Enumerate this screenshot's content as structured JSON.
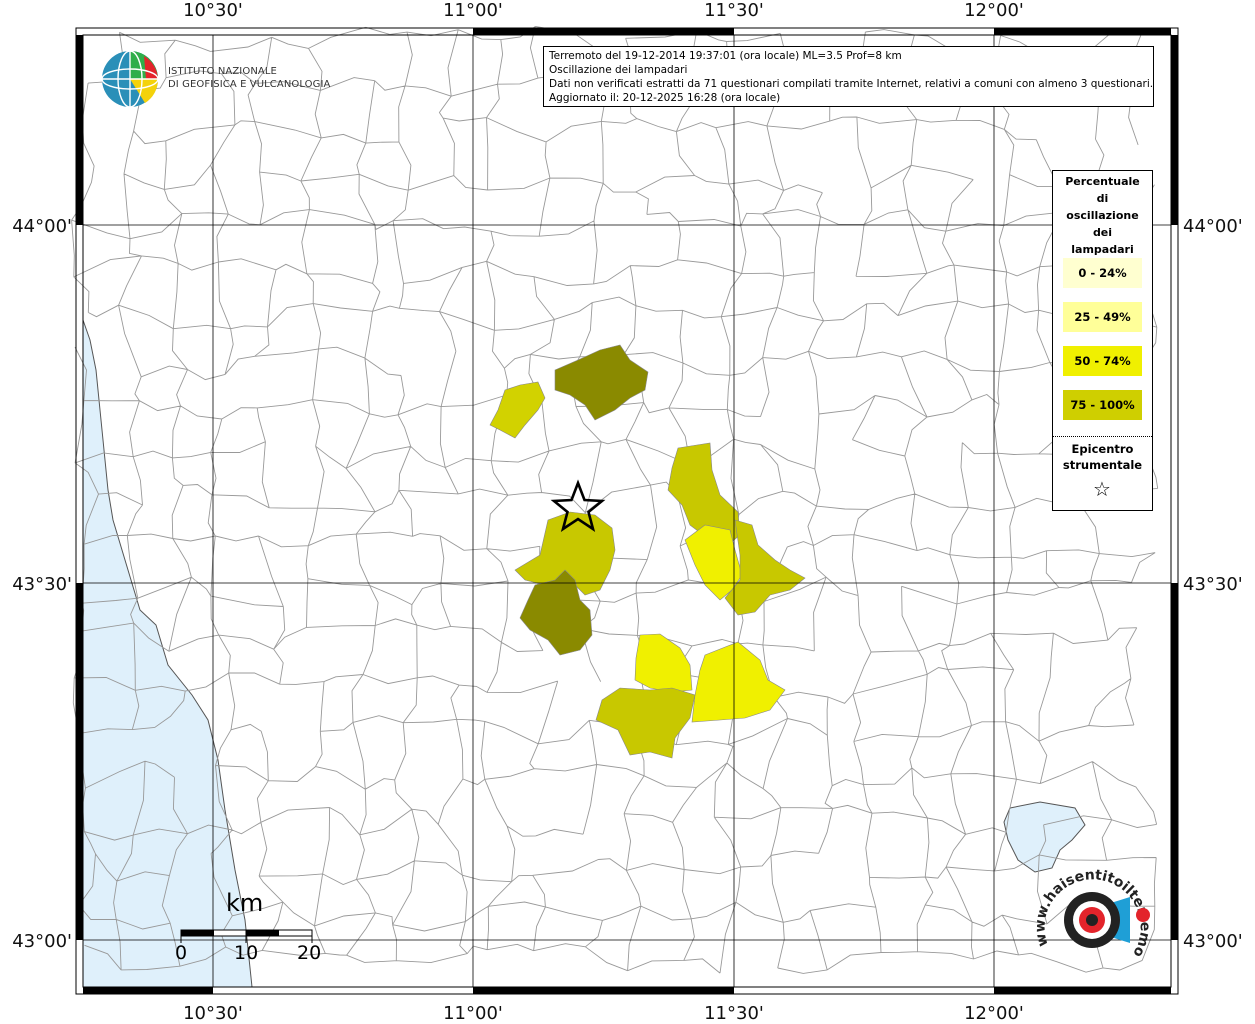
{
  "map": {
    "lon_ticks": [
      "10°30'",
      "11°00'",
      "11°30'",
      "12°00'"
    ],
    "lat_ticks": [
      "44°00'",
      "43°30'",
      "43°00'"
    ],
    "colors": {
      "sea": "#dff0fb",
      "class_0_24": "#ffffd0",
      "class_25_49": "#ffff99",
      "class_50_74": "#f0f000",
      "class_75_100": "#cfcf00",
      "dark_olive": "#8a8a00"
    }
  },
  "info_box": {
    "line1": "Terremoto del 19-12-2014 19:37:01 (ora locale) ML=3.5 Prof=8 km",
    "line2": "Oscillazione dei lampadari",
    "line3": "Dati non verificati estratti da 71 questionari compilati tramite Internet, relativi a comuni con almeno 3 questionari.",
    "line4": "Aggiornato il: 20-12-2025 16:28 (ora locale)"
  },
  "logo": {
    "line1": "ISTITUTO NAZIONALE",
    "line2": "DI GEOFISICA E VULCANOLOGIA"
  },
  "legend": {
    "title": [
      "Percentuale",
      "di",
      "oscillazione",
      "dei",
      "lampadari"
    ],
    "classes": [
      {
        "label": "0 - 24%",
        "color": "#ffffd0"
      },
      {
        "label": "25 - 49%",
        "color": "#ffff99"
      },
      {
        "label": "50 - 74%",
        "color": "#f0f000"
      },
      {
        "label": "75 - 100%",
        "color": "#cfcf00"
      }
    ],
    "epicenter_line1": "Epicentro",
    "epicenter_line2": "strumentale",
    "epicenter_symbol": "☆"
  },
  "scale_bar": {
    "unit": "km",
    "labels": [
      "0",
      "10",
      "20"
    ]
  },
  "haisentito": {
    "text": "www.haisentitoilterremoto.it"
  }
}
